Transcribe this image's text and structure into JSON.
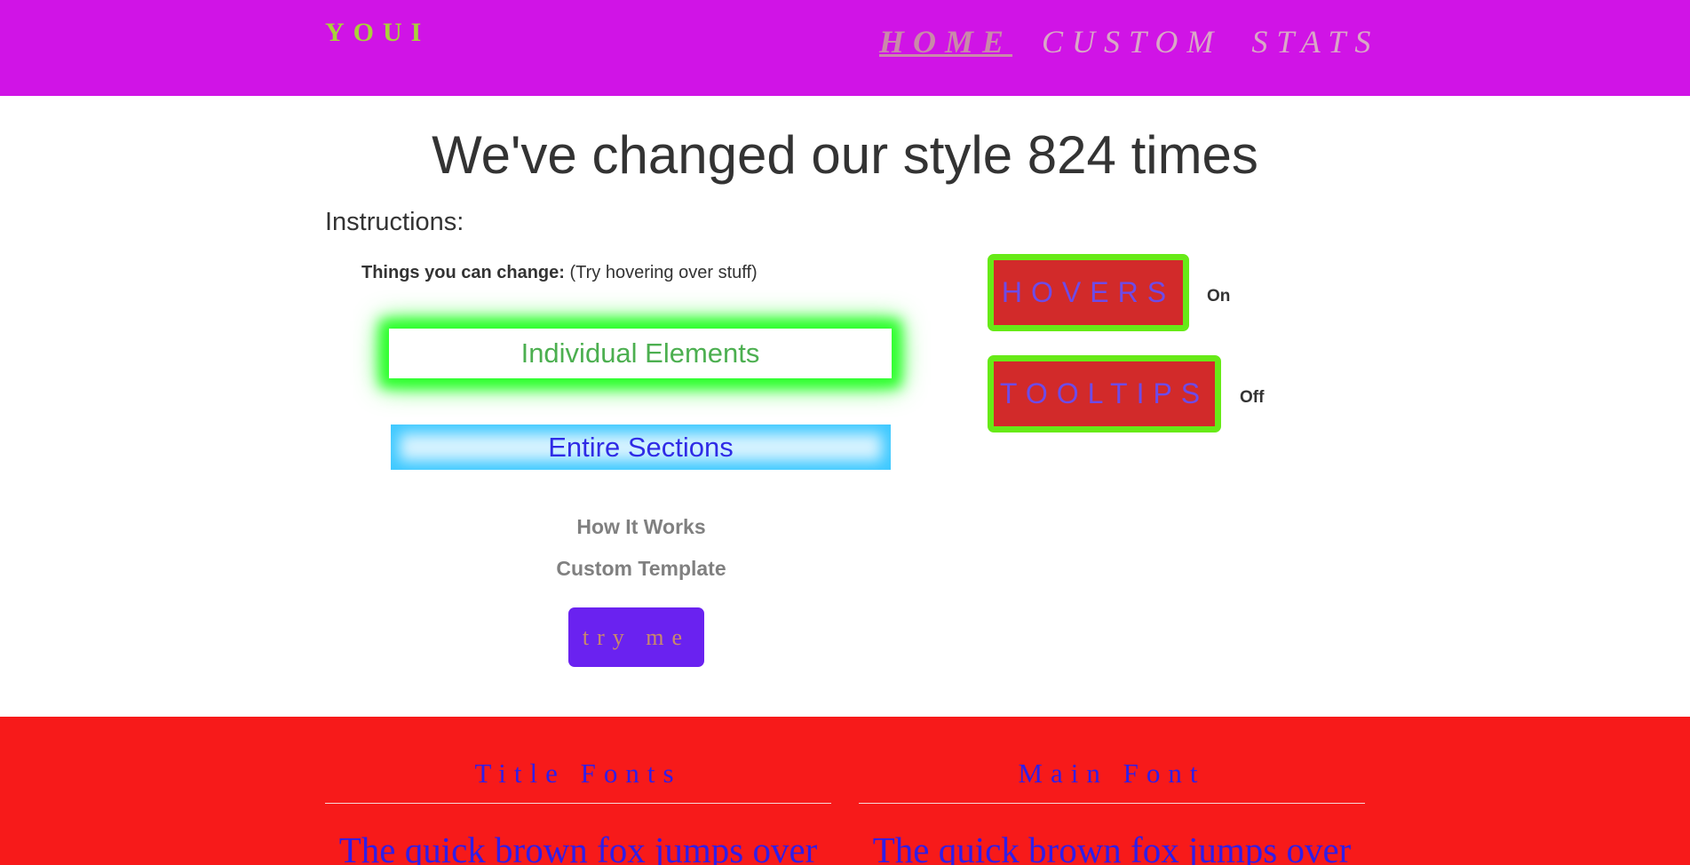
{
  "nav": {
    "logo": "YOUI",
    "home": "HOME",
    "custom": "CUSTOM",
    "stats": "STATS"
  },
  "main": {
    "title": "We've changed our style 824 times",
    "instructions": "Instructions:",
    "change_label": "Things you can change:",
    "change_hint": " (Try hovering over stuff)",
    "individual_elements": "Individual Elements",
    "entire_sections": "Entire Sections",
    "how_it_works": "How It Works",
    "custom_template": "Custom Template",
    "try_me": "try me"
  },
  "toggles": {
    "hovers": {
      "label": "HOVERS",
      "state": "On"
    },
    "tooltips": {
      "label": "TOOLTIPS",
      "state": "Off"
    }
  },
  "footer": {
    "title_fonts_heading": "Title Fonts",
    "main_font_heading": "Main Font",
    "title_fonts_sample": "The quick brown fox jumps over",
    "main_font_sample": "The quick brown fox jumps over"
  },
  "colors": {
    "nav_bg": "#d014e6",
    "footer_bg": "#f71a1a",
    "toggle_border": "#67ea17",
    "toggle_bg": "#d22a2a",
    "try_bg": "#6a22f0"
  }
}
